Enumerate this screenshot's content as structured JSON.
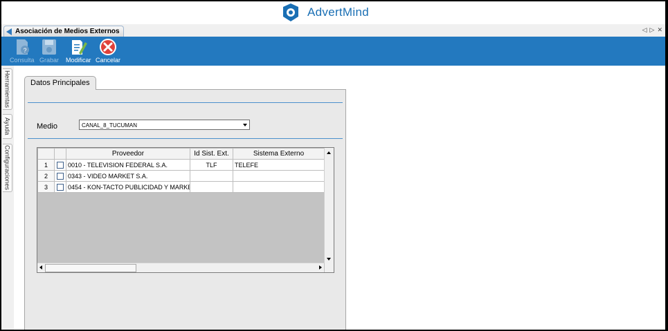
{
  "app": {
    "logo_text": "AdvertMind"
  },
  "tab": {
    "title": "Asociación de Medios Externos"
  },
  "toolbar": {
    "consulta": "Consulta",
    "grabar": "Grabar",
    "modificar": "Modificar",
    "cancelar": "Cancelar"
  },
  "sidebar": {
    "herramientas": "Herramientas",
    "ayuda": "Ayuda",
    "configuraciones": "Configuraciones"
  },
  "panel": {
    "tab_label": "Datos Principales",
    "medio_label": "Medio",
    "medio_value": "CANAL_8_TUCUMAN"
  },
  "grid": {
    "columns": [
      "Proveedor",
      "Id Sist. Ext.",
      "Sistema Externo"
    ],
    "rows": [
      {
        "num": "1",
        "proveedor": "0010 - TELEVISION FEDERAL S.A.",
        "id_sist_ext": "TLF",
        "sistema_externo": "TELEFE"
      },
      {
        "num": "2",
        "proveedor": "0343 - VIDEO MARKET S.A.",
        "id_sist_ext": "",
        "sistema_externo": ""
      },
      {
        "num": "3",
        "proveedor": "0454 - KON-TACTO PUBLICIDAD Y MARKE",
        "id_sist_ext": "",
        "sistema_externo": ""
      }
    ]
  },
  "colors": {
    "accent": "#2379bf",
    "cancel": "#e0413a"
  }
}
